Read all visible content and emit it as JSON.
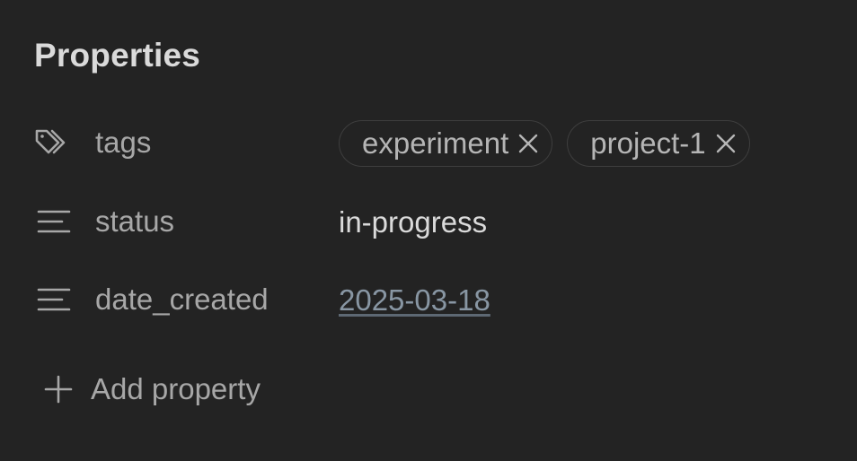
{
  "panel": {
    "title": "Properties"
  },
  "properties": [
    {
      "key": "tags",
      "icon": "tags-icon",
      "type": "tags",
      "tags": [
        "experiment",
        "project-1"
      ]
    },
    {
      "key": "status",
      "icon": "text-lines-icon",
      "type": "text",
      "value": "in-progress"
    },
    {
      "key": "date_created",
      "icon": "text-lines-icon",
      "type": "date",
      "value": "2025-03-18"
    }
  ],
  "add_property": {
    "label": "Add property",
    "icon": "plus-icon"
  },
  "colors": {
    "background": "#232323",
    "heading": "#dadada",
    "key_text": "#a7a7a7",
    "value_text": "#dadada",
    "date_link": "#8896a3",
    "pill_border": "#3e3e3e"
  }
}
